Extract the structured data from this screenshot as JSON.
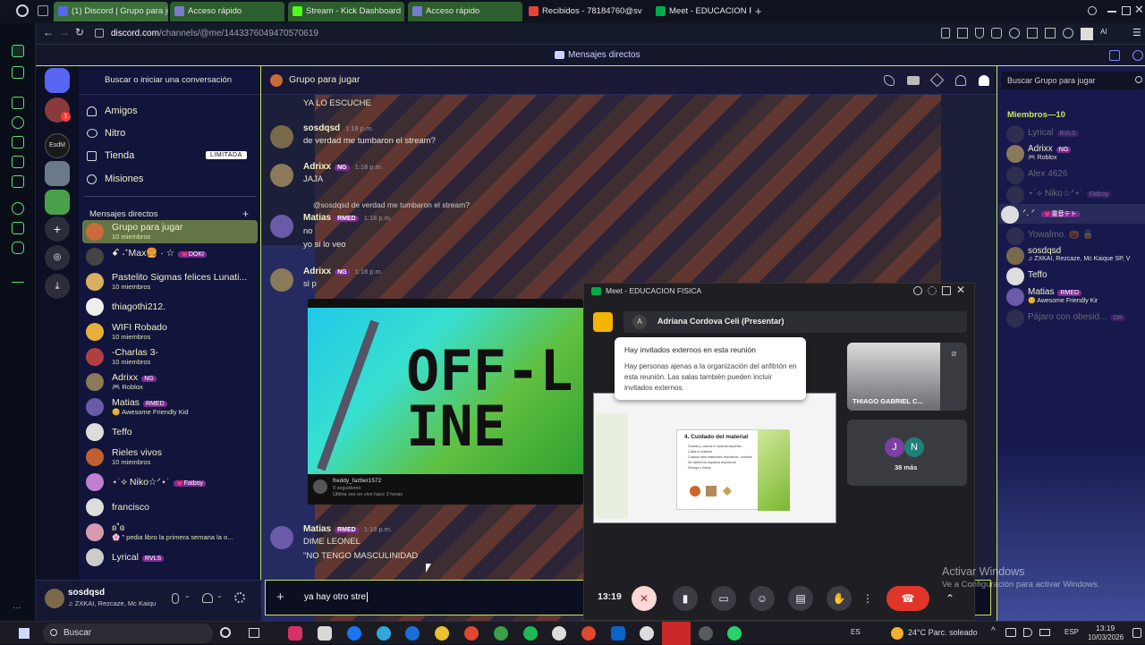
{
  "browser": {
    "tabs": [
      {
        "label": "(1) Discord | Grupo para jug",
        "color": "#5865f2",
        "active": true
      },
      {
        "label": "Acceso rápido",
        "color": "#8a8aff",
        "active": false
      },
      {
        "label": "Stream - Kick Dashboard",
        "color": "#53fc18",
        "active": false
      },
      {
        "label": "Acceso rápido",
        "color": "#8a8aff",
        "active": false
      },
      {
        "label": "Recibidos - 78184760@sv",
        "color": "#ea4335",
        "active": false
      },
      {
        "label": "Meet - EDUCACION FI",
        "color": "#00ac47",
        "active": false
      }
    ],
    "new_tab": "+",
    "url_host": "discord.com",
    "url_path": "/channels/@me/1443376049470570619"
  },
  "discord": {
    "top_title": "Mensajes directos",
    "search_conversation": "Buscar o iniciar una conversación",
    "nav": [
      {
        "label": "Amigos",
        "icon": "friends-icon"
      },
      {
        "label": "Nitro",
        "icon": "nitro-icon"
      },
      {
        "label": "Tienda",
        "icon": "shop-icon",
        "badge": "LIMITADA"
      },
      {
        "label": "Misiones",
        "icon": "quests-icon"
      }
    ],
    "dm_header": "Mensajes directos",
    "dm_add": "+",
    "dms": [
      {
        "name": "Grupo para jugar",
        "sub": "10 miembros",
        "color": "#c96b3a",
        "selected": true
      },
      {
        "name": "ꗃ ˖⁺Max🍔 · ☆",
        "tag": "💗DOKI",
        "color": "#444"
      },
      {
        "name": "Pastelito Sigmas felices Lunati...",
        "sub": "10 miembros",
        "color": "#d8b060"
      },
      {
        "name": "thiagothi212.",
        "color": "#eee"
      },
      {
        "name": "WIFI Robado",
        "sub": "10 miembros",
        "color": "#e8b03a"
      },
      {
        "name": "-Charlas 3-",
        "sub": "10 miembros",
        "color": "#b04040"
      },
      {
        "name": "Adrixx",
        "tag": "NG",
        "sub": "🎮 Roblox",
        "color": "#8a7a5a"
      },
      {
        "name": "Matias",
        "tag": "RMED",
        "sub": "😊 Awesome Friendly Kid",
        "color": "#6a5aa8"
      },
      {
        "name": "Teffo",
        "color": "#ddd"
      },
      {
        "name": "Rieles vivos",
        "sub": "10 miembros",
        "color": "#c06030"
      },
      {
        "name": "⋆˙⟡ Niko☆ᐟ⋆˙",
        "tag": "💗Fatboy",
        "color": "#c080d0"
      },
      {
        "name": "francisco",
        "color": "#ddd"
      },
      {
        "name": "ʚ˚ɞ",
        "sub": "🌸 \" pedia libro la primera semana la o...",
        "color": "#d89ab0"
      },
      {
        "name": "Lyrical",
        "tag": "RVLS",
        "color": "#ccc"
      }
    ],
    "user": {
      "name": "sosdqsd",
      "status": "♫ ZXKAI, Rezcaze, Mc Kaiqu"
    },
    "channel_title": "Grupo para jugar",
    "channel_search_placeholder": "Buscar Grupo para jugar",
    "messages": [
      {
        "text": "YA LO ESCUCHE"
      },
      {
        "author": "sosdqsd",
        "time": "1:18 p.m.",
        "text": "de verdad me tumbaron el stream?",
        "color": "#7a6a4a"
      },
      {
        "author": "Adrixx",
        "tag": "NG",
        "time": "1:18 p.m.",
        "text": "JAJA",
        "color": "#8a7a5a"
      },
      {
        "reply": "@sosdqsd de verdad me tumbaron el stream?",
        "author": "Matias",
        "tag": "RMED",
        "time": "1:18 p.m.",
        "lines": [
          "no",
          "yo si lo veo"
        ],
        "color": "#6a5aa8"
      },
      {
        "author": "Adrixx",
        "tag": "NG",
        "time": "1:18 p.m.",
        "text": "si p",
        "color": "#8a7a5a"
      },
      {
        "author": "Matias",
        "tag": "RMED",
        "time": "1:19 p.m.",
        "lines": [
          "DIME LEONEL",
          "\"NO TENGO MASCULINIDAD"
        ],
        "color": "#6a5aa8"
      }
    ],
    "embed": {
      "offline_text": "OFF-LINE",
      "streamer": "freddy_fazber1572",
      "streamer_sub": "0 seguidores",
      "streamer_note": "Última vez en vivo hace 3 horas"
    },
    "composer_value": "ya hay otro stre",
    "members_header": "Miembros—10",
    "members": [
      {
        "name": "Lyrical",
        "tag": "RVLS",
        "dim": true,
        "color": "#555"
      },
      {
        "name": "Adrixx",
        "tag": "NG",
        "sub": "🎮 Roblox",
        "color": "#8a7a5a"
      },
      {
        "name": "Alex 4626",
        "dim": true,
        "color": "#555"
      },
      {
        "name": "⋆˙⟡ Niko☆ᐟ⋆˙",
        "tag": "Fatboy",
        "dim": true,
        "color": "#555"
      },
      {
        "name": "ᐟ. ᐟ ",
        "tag": "💗童音テト",
        "color": "#ddd"
      },
      {
        "name": "Yowalmo. 🎃 🔒",
        "dim": true,
        "color": "#555"
      },
      {
        "name": "sosdqsd",
        "sub": "♫ ZXKAI, Rezcaze, Mc Kaique SP, V",
        "color": "#7a6a4a"
      },
      {
        "name": "Teffo",
        "color": "#ddd"
      },
      {
        "name": "Matias",
        "tag": "RMED",
        "sub": "😊 Awesome Friendly Kir",
        "color": "#6a5aa8"
      },
      {
        "name": "Pájaro con obesid...",
        "tag": "OR",
        "dim": true,
        "color": "#555"
      }
    ]
  },
  "meet": {
    "title": "Meet - EDUCACION FISICA",
    "presenter": "Adriana Cordova Celi (Presentar)",
    "presenter_initial": "A",
    "notice_title": "Hay invitados externos en esta reunión",
    "notice_body": "Hay personas ajenas a la organización del anfitrión en esta reunión. Las salas también pueden incluir invitados externos.",
    "slide_title": "4. Cuidado del material",
    "slide_bullets": [
      "Guarda y ordena el material deportivo",
      "Cuida el material",
      "Cuando uses materiales deportivos, cuídalos",
      "No dañes los espacios deportivos",
      "Recoge y limpia"
    ],
    "participant_name": "THIAGO GABRIEL C...",
    "more_initials": [
      "J",
      "N"
    ],
    "more_label": "38 más",
    "clock": "13:19"
  },
  "watermark": {
    "line1": "Activar Windows",
    "line2": "Ve a Configuración para activar Windows."
  },
  "taskbar": {
    "search_placeholder": "Buscar",
    "lang": "ES",
    "weather": "24°C  Parc. soleado",
    "kbd": "ESP",
    "time": "13:19",
    "date": "10/03/2026"
  }
}
